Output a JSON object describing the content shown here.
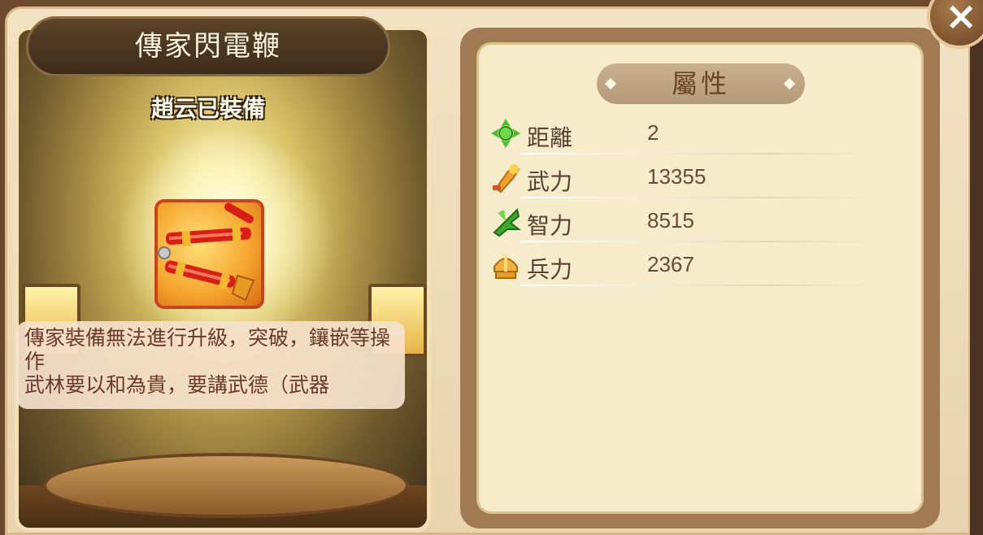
{
  "item": {
    "name": "傳家閃電鞭",
    "equip_status": "趙云已裝備",
    "description": "傳家裝備無法進行升級，突破，鑲嵌等操作\n武林要以和為貴，要講武德（武器"
  },
  "attributes": {
    "header": "屬性",
    "stats": [
      {
        "label": "距離",
        "value": "2",
        "icon": "range-icon"
      },
      {
        "label": "武力",
        "value": "13355",
        "icon": "force-icon"
      },
      {
        "label": "智力",
        "value": "8515",
        "icon": "intelligence-icon"
      },
      {
        "label": "兵力",
        "value": "2367",
        "icon": "troops-icon"
      }
    ]
  },
  "close_label": "×",
  "colors": {
    "panel_bg": "#f6eccc",
    "frame": "#a07a52",
    "desc_text": "#6b3a2a",
    "item_border": "#c8431e"
  }
}
